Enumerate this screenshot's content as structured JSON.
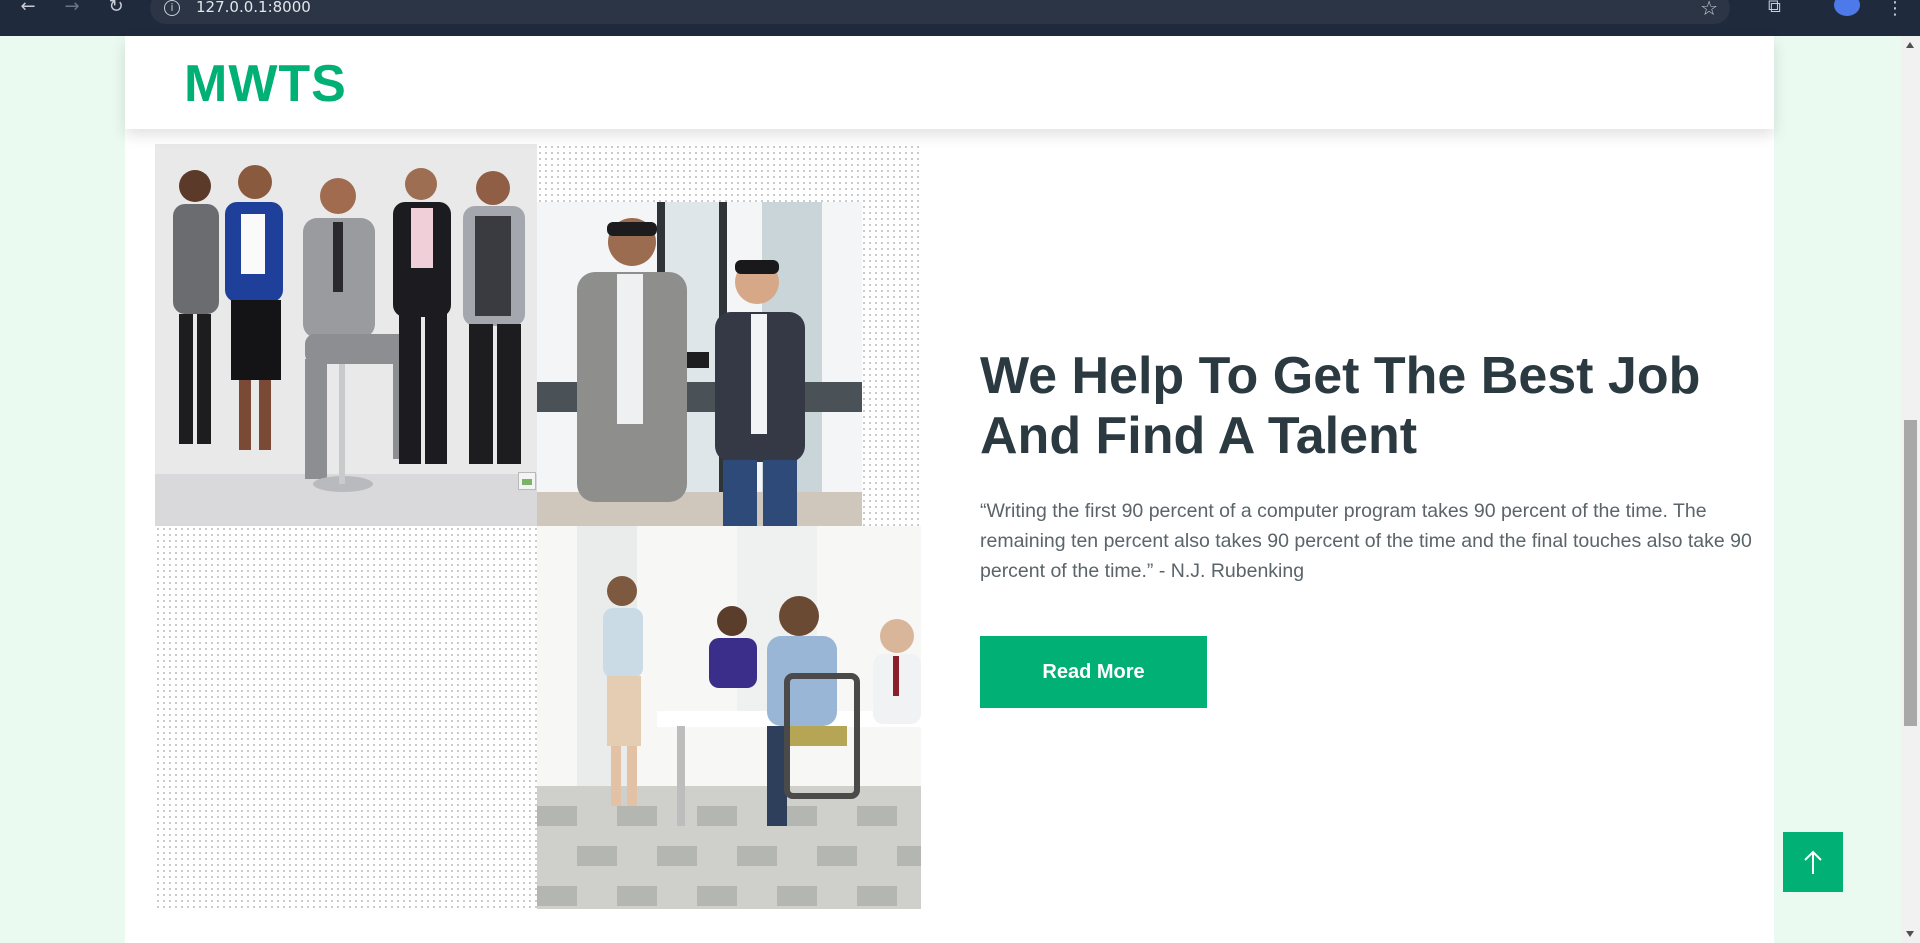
{
  "browser": {
    "url": "127.0.0.1:8000",
    "icons": [
      "back-arrow-icon",
      "forward-arrow-icon",
      "reload-icon",
      "info-icon",
      "bookmark-star-icon",
      "extensions-icon",
      "profile-avatar",
      "menu-dots-icon"
    ]
  },
  "header": {
    "logo": "MWTS"
  },
  "about": {
    "title": "We Help To Get The Best Job And Find A Talent",
    "quote": "“Writing the first 90 percent of a computer program takes 90 percent of the time. The remaining ten percent also takes 90 percent of the time and the final touches also take 90 percent of the time.” - N.J. Rubenking",
    "button_label": "Read More"
  },
  "colors": {
    "accent": "#00b074",
    "heading": "#2b3940",
    "body_text": "#5a6469",
    "page_bg": "#eafaf0"
  }
}
